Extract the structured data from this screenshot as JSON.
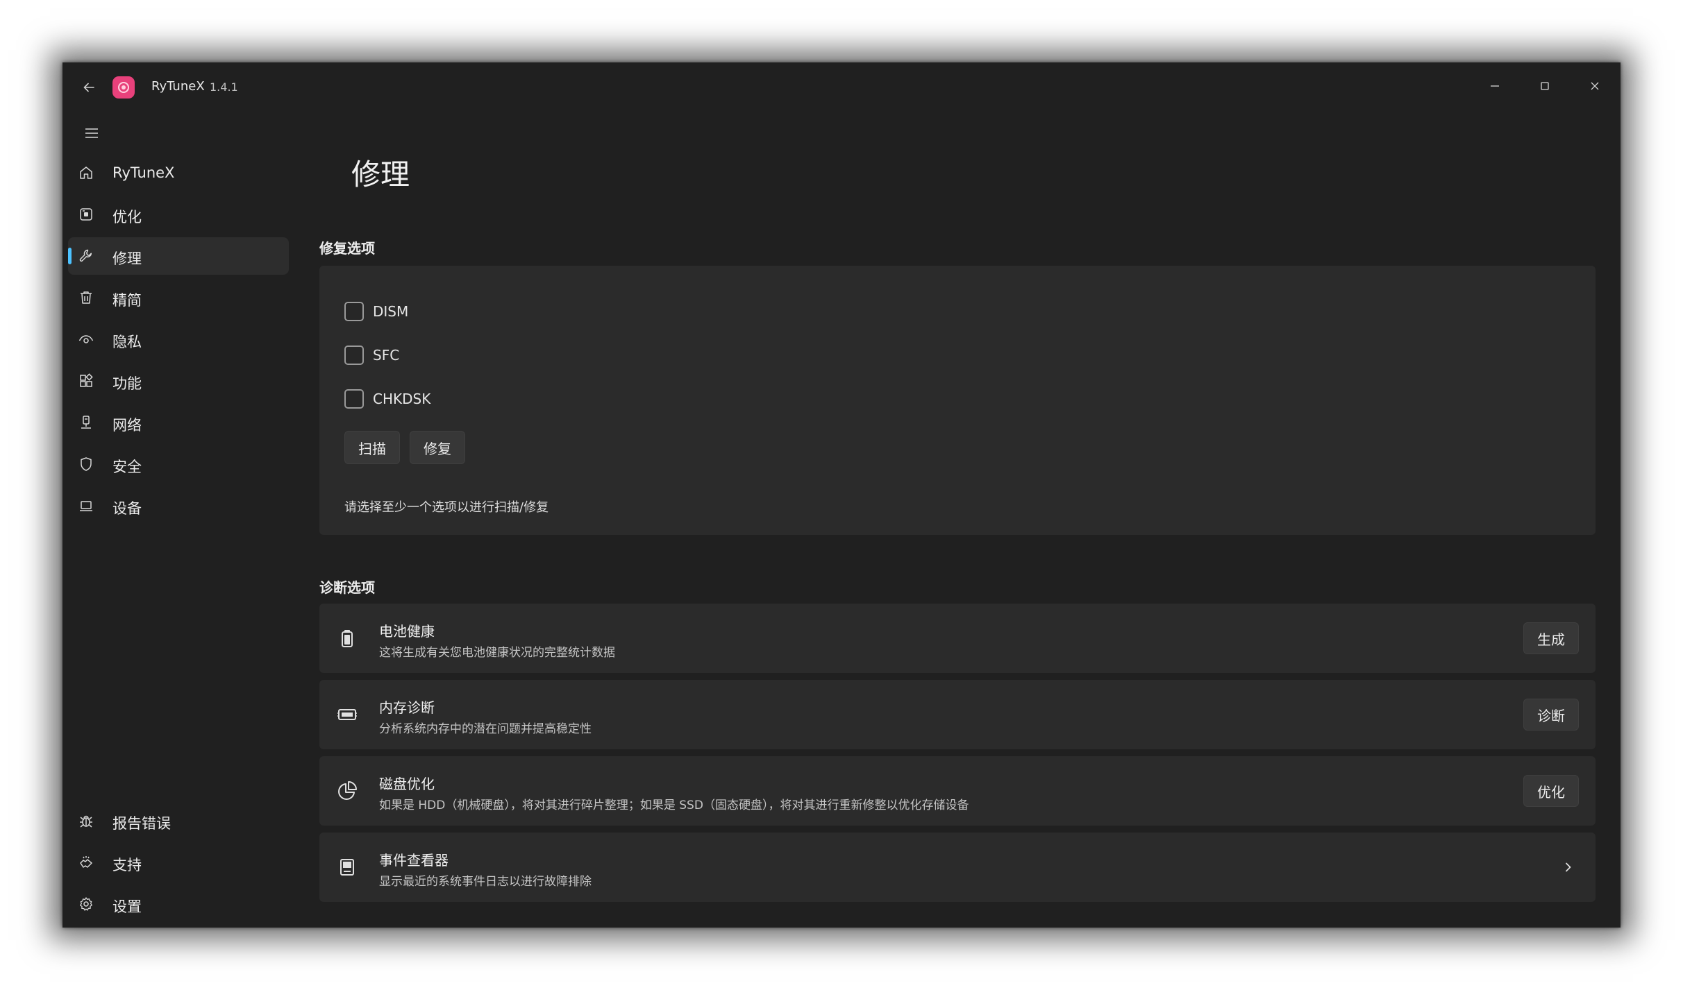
{
  "app": {
    "title": "RyTuneX",
    "version": "1.4.1",
    "accent": "#e8417b",
    "nav_indicator": "#4cc2ff"
  },
  "sidebar": {
    "items": [
      {
        "label": "RyTuneX",
        "icon": "home-icon"
      },
      {
        "label": "优化",
        "icon": "optimize-icon"
      },
      {
        "label": "修理",
        "icon": "wrench-icon",
        "active": true
      },
      {
        "label": "精简",
        "icon": "trash-icon"
      },
      {
        "label": "隐私",
        "icon": "eye-icon"
      },
      {
        "label": "功能",
        "icon": "apps-icon"
      },
      {
        "label": "网络",
        "icon": "network-icon"
      },
      {
        "label": "安全",
        "icon": "shield-icon"
      },
      {
        "label": "设备",
        "icon": "laptop-icon"
      }
    ],
    "footer_items": [
      {
        "label": "报告错误",
        "icon": "bug-icon"
      },
      {
        "label": "支持",
        "icon": "support-icon"
      },
      {
        "label": "设置",
        "icon": "gear-icon"
      }
    ]
  },
  "main": {
    "page_title": "修理",
    "repair": {
      "section_title": "修复选项",
      "options": [
        {
          "label": "DISM",
          "checked": false
        },
        {
          "label": "SFC",
          "checked": false
        },
        {
          "label": "CHKDSK",
          "checked": false
        }
      ],
      "scan_label": "扫描",
      "fix_label": "修复",
      "hint": "请选择至少一个选项以进行扫描/修复"
    },
    "diagnostics": {
      "section_title": "诊断选项",
      "items": [
        {
          "title": "电池健康",
          "desc": "这将生成有关您电池健康状况的完整统计数据",
          "action": "生成",
          "icon": "battery-icon"
        },
        {
          "title": "内存诊断",
          "desc": "分析系统内存中的潜在问题并提高稳定性",
          "action": "诊断",
          "icon": "memory-icon"
        },
        {
          "title": "磁盘优化",
          "desc": "如果是 HDD（机械硬盘），将对其进行碎片整理；如果是 SSD（固态硬盘），将对其进行重新修整以优化存储设备",
          "action": "优化",
          "icon": "disk-chart-icon"
        },
        {
          "title": "事件查看器",
          "desc": "显示最近的系统事件日志以进行故障排除",
          "action": "",
          "icon": "event-viewer-icon"
        }
      ]
    }
  }
}
